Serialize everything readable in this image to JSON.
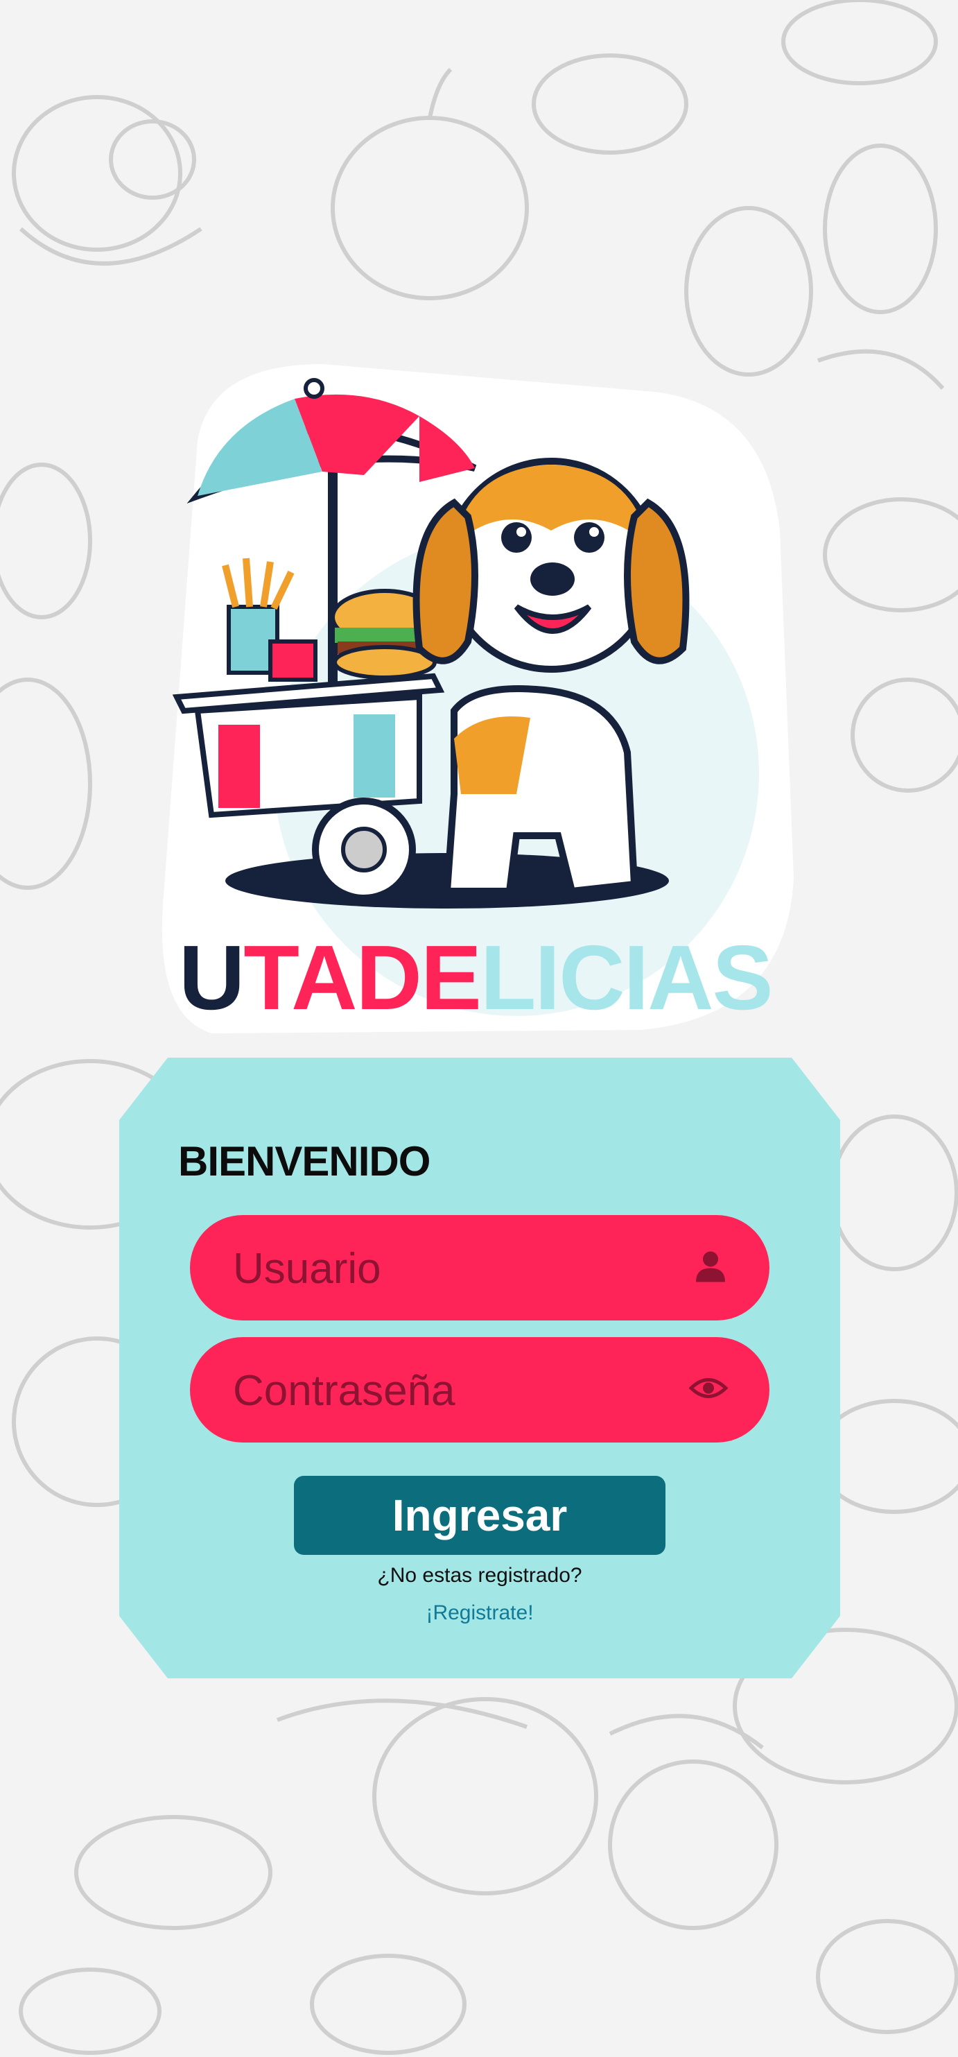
{
  "brand": {
    "parts": [
      "U",
      "TADE",
      "LICIAS"
    ],
    "colors": {
      "dark": "#16213b",
      "red": "#ff2457",
      "cyan": "#a6e6ea"
    }
  },
  "login": {
    "title": "BIENVENIDO",
    "username_placeholder": "Usuario",
    "password_placeholder": "Contraseña",
    "submit_label": "Ingresar",
    "register_prompt": "¿No estas registrado?",
    "register_link": "¡Registrate!"
  },
  "icons": {
    "username": "user-icon",
    "password": "eye-icon",
    "logo": "beagle-food-cart-logo",
    "background": "food-doodle-pattern"
  },
  "colors": {
    "card": "#a3e6e6",
    "field": "#ff2457",
    "button": "#0c6e7c",
    "link": "#127a96"
  }
}
